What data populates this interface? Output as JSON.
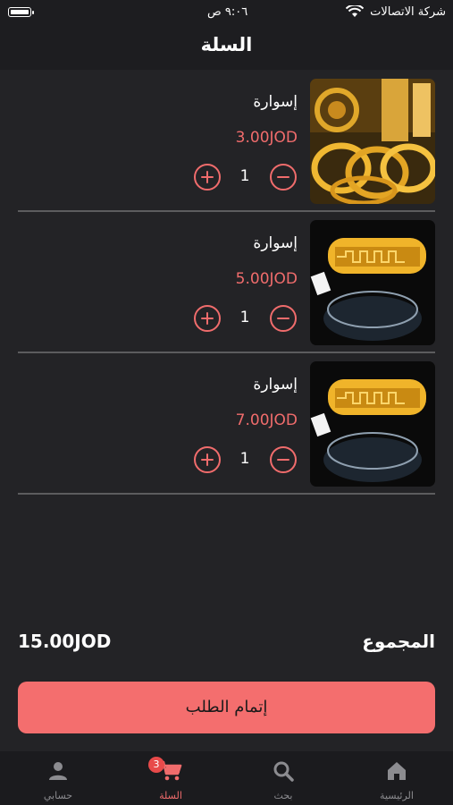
{
  "status_bar": {
    "carrier": "شركة الاتصالات",
    "time": "٩:٠٦ ص"
  },
  "header": {
    "title": "السلة"
  },
  "cart": {
    "items": [
      {
        "name": "إسوارة",
        "price": "3.00JOD",
        "quantity": "1",
        "image_icon": "gold-bangles-image"
      },
      {
        "name": "إسوارة",
        "price": "5.00JOD",
        "quantity": "1",
        "image_icon": "gold-bangle-image"
      },
      {
        "name": "إسوارة",
        "price": "7.00JOD",
        "quantity": "1",
        "image_icon": "gold-bangle-image"
      }
    ]
  },
  "summary": {
    "total_label": "المجموع",
    "total_value": "15.00JOD"
  },
  "checkout": {
    "label": "إتمام الطلب"
  },
  "tab_bar": {
    "tabs": [
      {
        "label": "الرئيسية",
        "icon": "home-icon"
      },
      {
        "label": "بحث",
        "icon": "search-icon"
      },
      {
        "label": "السلة",
        "icon": "cart-icon",
        "badge": "3",
        "active": true
      },
      {
        "label": "حسابي",
        "icon": "account-icon"
      }
    ]
  },
  "colors": {
    "accent": "#f06c6c",
    "background": "#232326",
    "button": "#f46e6e"
  }
}
